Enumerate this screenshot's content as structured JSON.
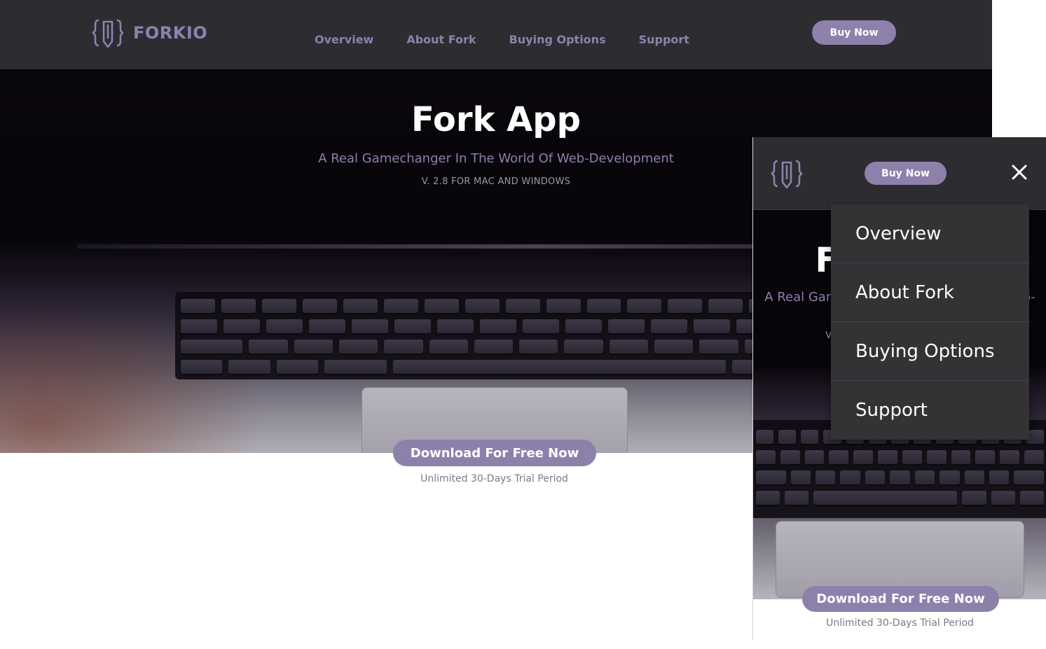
{
  "desktop": {
    "logo_text": "FORKIO",
    "nav": [
      "Overview",
      "About Fork",
      "Buying Options",
      "Support"
    ],
    "buy_label": "Buy Now",
    "hero": {
      "title": "Fork App",
      "subtitle": "A Real Gamechanger In The World Of Web-Development",
      "version": "V. 2.8 FOR MAC AND WINDOWS"
    },
    "cta_label": "Download For Free Now",
    "trial_text": "Unlimited 30-Days Trial Period"
  },
  "mobile": {
    "buy_label": "Buy Now",
    "hero": {
      "title": "Fork App",
      "subtitle": "A Real Gamechanger In The World Of Web-Development",
      "version": "V. 2.8 FOR MAC AND WINDOWS"
    },
    "menu_items": [
      "Overview",
      "About Fork",
      "Buying Options",
      "Support"
    ],
    "menu_open": true,
    "cta_label": "Download For Free Now",
    "trial_text": "Unlimited 30-Days Trial Period"
  },
  "colors": {
    "accent": "#8d81ac",
    "header_bg": "#2d2c31",
    "menu_bg": "#333235",
    "hero_bg": "#07050a"
  },
  "icons": {
    "logo": "curly-braces-pencil-icon",
    "close": "close-icon"
  }
}
